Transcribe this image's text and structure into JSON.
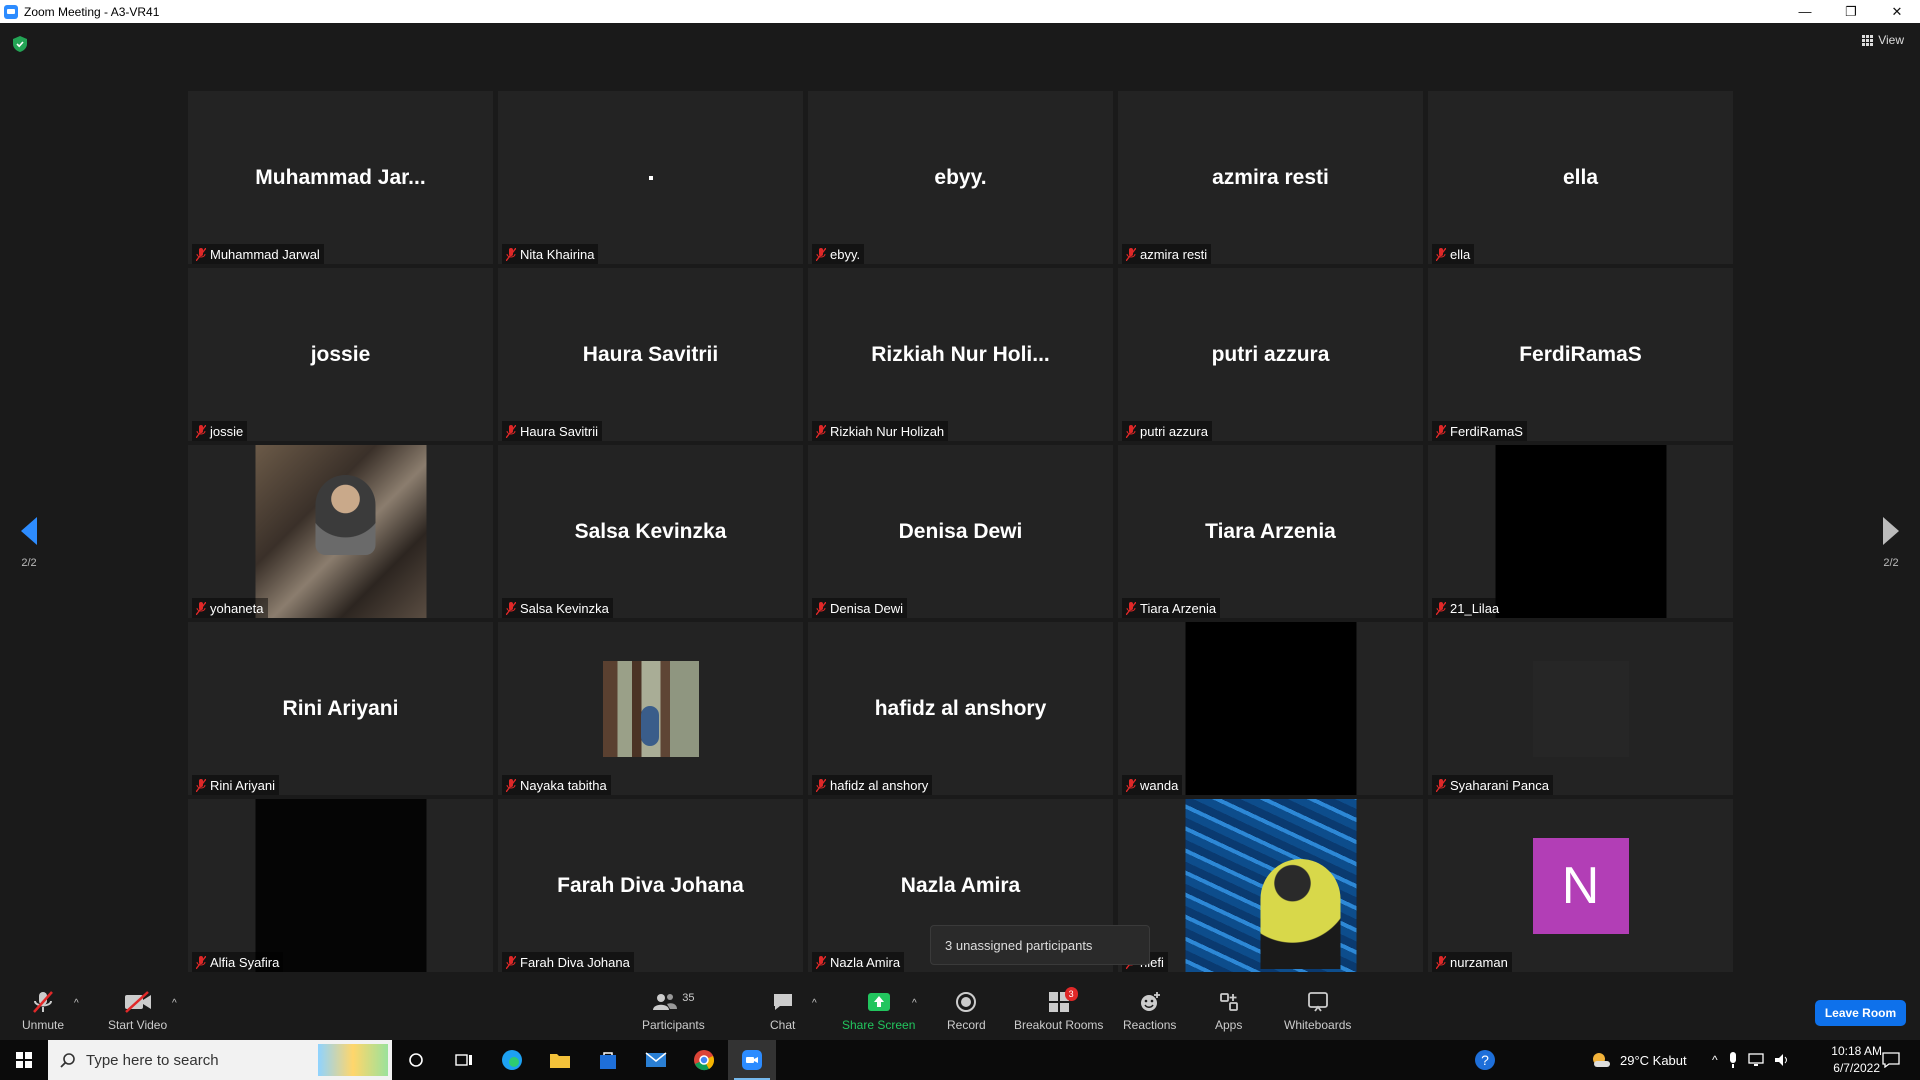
{
  "window": {
    "title": "Zoom Meeting - A3-VR41",
    "minimize": "—",
    "restore": "❐",
    "close": "✕"
  },
  "view_button": "View",
  "tiles": [
    {
      "display": "Muhammad  Jar...",
      "label": "Muhammad Jarwal",
      "kind": "name"
    },
    {
      "display": "",
      "label": "Nita Khairina",
      "kind": "dot"
    },
    {
      "display": "ebyy.",
      "label": "ebyy.",
      "kind": "name"
    },
    {
      "display": "azmira resti",
      "label": "azmira resti",
      "kind": "name"
    },
    {
      "display": "ella",
      "label": "ella",
      "kind": "name"
    },
    {
      "display": "jossie",
      "label": "jossie",
      "kind": "name"
    },
    {
      "display": "Haura Savitrii",
      "label": "Haura Savitrii",
      "kind": "name"
    },
    {
      "display": "Rizkiah  Nur  Holi...",
      "label": "Rizkiah Nur Holizah",
      "kind": "name"
    },
    {
      "display": "putri azzura",
      "label": "putri azzura",
      "kind": "name"
    },
    {
      "display": "FerdiRamaS",
      "label": "FerdiRamaS",
      "kind": "name"
    },
    {
      "display": "",
      "label": "yohaneta",
      "kind": "video-kitchen"
    },
    {
      "display": "Salsa Kevinzka",
      "label": "Salsa Kevinzka",
      "kind": "name"
    },
    {
      "display": "Denisa Dewi",
      "label": "Denisa Dewi",
      "kind": "name"
    },
    {
      "display": "Tiara Arzenia",
      "label": "Tiara Arzenia",
      "kind": "name"
    },
    {
      "display": "",
      "label": "21_Lilaa",
      "kind": "video-black"
    },
    {
      "display": "Rini Ariyani",
      "label": "Rini Ariyani",
      "kind": "name"
    },
    {
      "display": "",
      "label": "Nayaka tabitha",
      "kind": "photo"
    },
    {
      "display": "hafidz al anshory",
      "label": "hafidz al anshory",
      "kind": "name"
    },
    {
      "display": "",
      "label": "wanda",
      "kind": "video-black"
    },
    {
      "display": "",
      "label": "Syaharani Panca",
      "kind": "faint"
    },
    {
      "display": "",
      "label": "Alfia Syafira",
      "kind": "video-dark"
    },
    {
      "display": "Farah Diva Johana",
      "label": "Farah Diva Johana",
      "kind": "name"
    },
    {
      "display": "Nazla Amira",
      "label": "Nazla Amira",
      "kind": "name"
    },
    {
      "display": "",
      "label": "hlefi",
      "kind": "video-pool"
    },
    {
      "display": "",
      "label": "nurzaman",
      "kind": "avatar",
      "avatar_letter": "N"
    }
  ],
  "pager": {
    "left": "2/2",
    "right": "2/2"
  },
  "toast": "3 unassigned participants",
  "toolbar": {
    "unmute": "Unmute",
    "start_video": "Start Video",
    "participants": "Participants",
    "participants_count": "35",
    "chat": "Chat",
    "share_screen": "Share Screen",
    "record": "Record",
    "breakout_rooms": "Breakout Rooms",
    "breakout_badge": "3",
    "reactions": "Reactions",
    "apps": "Apps",
    "whiteboards": "Whiteboards",
    "leave": "Leave Room"
  },
  "taskbar": {
    "search_placeholder": "Type here to search",
    "weather": "29°C  Kabut",
    "time": "10:18 AM",
    "date": "6/7/2022"
  },
  "colors": {
    "accent": "#2d8cff",
    "leave": "#0e71eb",
    "muted_mic": "#e02828",
    "share_green": "#22c55e",
    "avatar": "#b23eb6"
  }
}
